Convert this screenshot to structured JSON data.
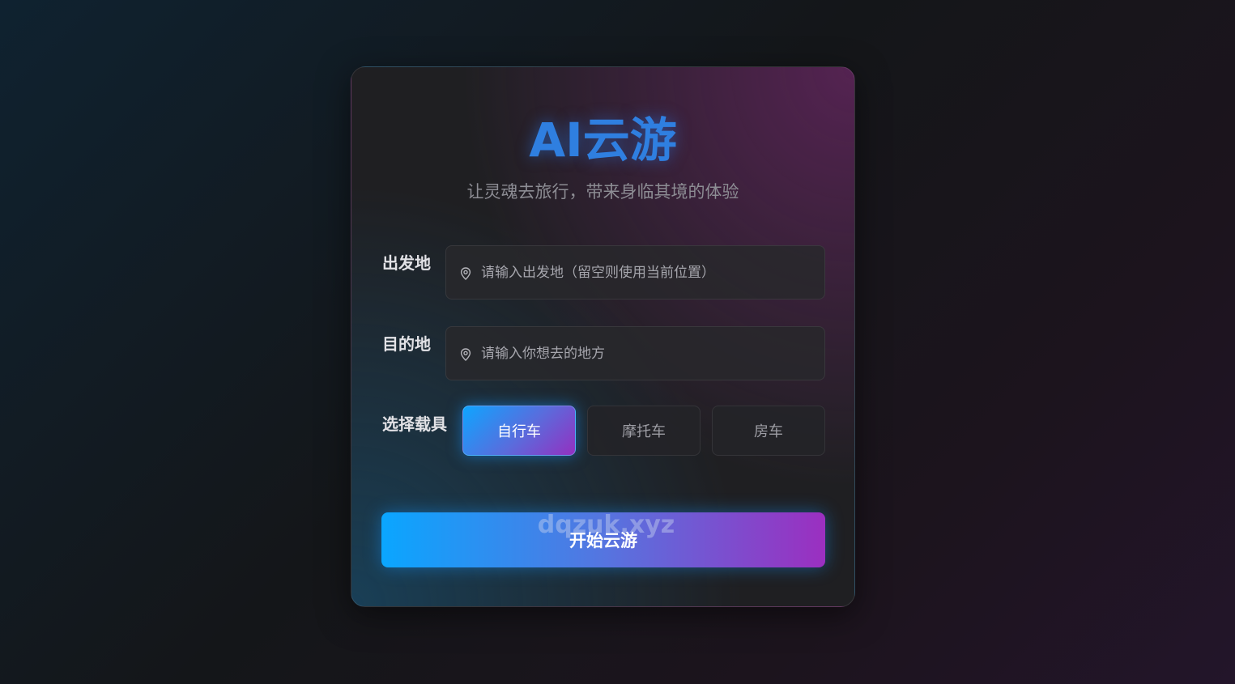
{
  "app": {
    "title": "AI云游",
    "subtitle": "让灵魂去旅行，带来身临其境的体验"
  },
  "form": {
    "origin": {
      "label": "出发地",
      "placeholder": "请输入出发地（留空则使用当前位置）",
      "value": "",
      "icon": "location-pin-icon"
    },
    "destination": {
      "label": "目的地",
      "placeholder": "请输入你想去的地方",
      "value": "",
      "icon": "location-pin-icon"
    },
    "vehicle": {
      "label": "选择载具",
      "options": [
        "自行车",
        "摩托车",
        "房车"
      ],
      "selected": "自行车"
    },
    "submit_label": "开始云游"
  },
  "watermark": "dqzuk.xyz",
  "colors": {
    "accent_blue": "#0ea5ff",
    "accent_purple": "#9430c0",
    "title_blue": "#2f7fe0"
  }
}
